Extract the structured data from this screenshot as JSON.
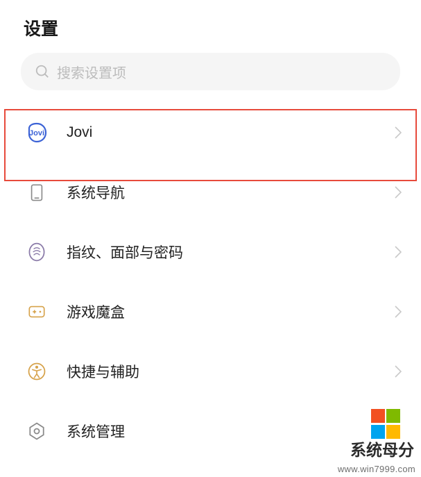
{
  "title": "设置",
  "search": {
    "placeholder": "搜索设置项"
  },
  "items": {
    "jovi": {
      "label": "Jovi"
    },
    "nav": {
      "label": "系统导航"
    },
    "biometric": {
      "label": "指纹、面部与密码"
    },
    "gamebox": {
      "label": "游戏魔盒"
    },
    "shortcut": {
      "label": "快捷与辅助"
    },
    "sysmgr": {
      "label": "系统管理"
    }
  },
  "watermark": {
    "brand": "系统⺟分",
    "url": "www.win7999.com",
    "colors": [
      "#f25022",
      "#7fba00",
      "#00a4ef",
      "#ffb900"
    ]
  }
}
